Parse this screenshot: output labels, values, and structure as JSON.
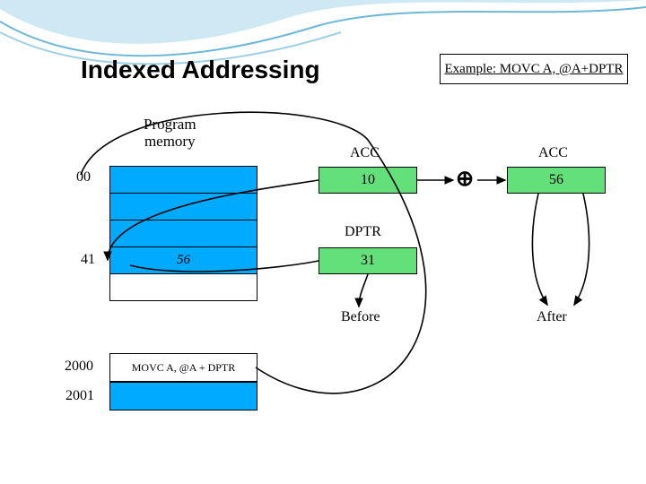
{
  "title": "Indexed Addressing",
  "example_label": "Example: MOVC A, @A+DPTR",
  "pm_label_line1": "Program",
  "pm_label_line2": "memory",
  "addresses": {
    "r0": "00",
    "r41": "41",
    "r2000": "2000",
    "r2001": "2001"
  },
  "mem_val_41": "56",
  "instr": "MOVC A, @A + DPTR",
  "labels": {
    "acc": "ACC",
    "dptr": "DPTR",
    "before": "Before",
    "after": "After"
  },
  "registers": {
    "acc_before": "10",
    "dptr_before": "31",
    "acc_after": "56"
  },
  "op_symbol": "⊕"
}
